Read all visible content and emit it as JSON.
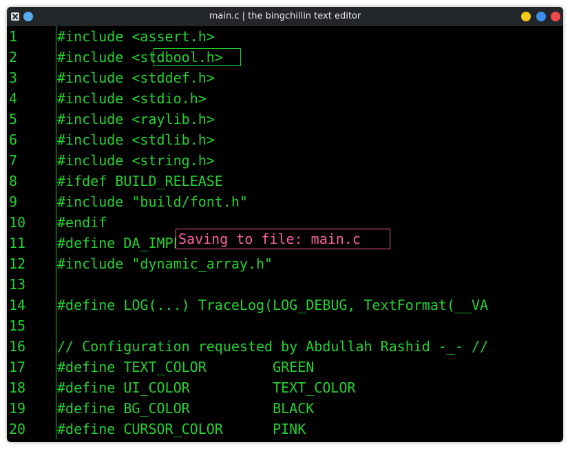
{
  "window": {
    "title": "main.c | the bingchillin text editor"
  },
  "editor": {
    "lines": [
      {
        "num": "1",
        "text": "#include <assert.h>"
      },
      {
        "num": "2",
        "text": "#include <stdbool.h>"
      },
      {
        "num": "3",
        "text": "#include <stddef.h>"
      },
      {
        "num": "4",
        "text": "#include <stdio.h>"
      },
      {
        "num": "5",
        "text": "#include <raylib.h>"
      },
      {
        "num": "6",
        "text": "#include <stdlib.h>"
      },
      {
        "num": "7",
        "text": "#include <string.h>"
      },
      {
        "num": "8",
        "text": "#ifdef BUILD_RELEASE"
      },
      {
        "num": "9",
        "text": "#include \"build/font.h\""
      },
      {
        "num": "10",
        "text": "#endif"
      },
      {
        "num": "11",
        "text": "#define DA_IMPLEMENTATION"
      },
      {
        "num": "12",
        "text": "#include \"dynamic_array.h\""
      },
      {
        "num": "13",
        "text": ""
      },
      {
        "num": "14",
        "text": "#define LOG(...) TraceLog(LOG_DEBUG, TextFormat(__VA"
      },
      {
        "num": "15",
        "text": ""
      },
      {
        "num": "16",
        "text": "// Configuration requested by Abdullah Rashid -_- //"
      },
      {
        "num": "17",
        "text": "#define TEXT_COLOR        GREEN"
      },
      {
        "num": "18",
        "text": "#define UI_COLOR          TEXT_COLOR"
      },
      {
        "num": "19",
        "text": "#define BG_COLOR          BLACK"
      },
      {
        "num": "20",
        "text": "#define CURSOR_COLOR      PINK"
      }
    ],
    "status_message": "Saving to file: main.c"
  },
  "colors": {
    "text": "#22d32e",
    "background": "#000000",
    "cursor": "#ff5fa8",
    "titlebar": "#232629"
  },
  "icons": {
    "app": "app-icon",
    "pin": "pin-icon",
    "minimize": "minimize-icon",
    "maximize": "maximize-icon",
    "close": "close-icon"
  }
}
